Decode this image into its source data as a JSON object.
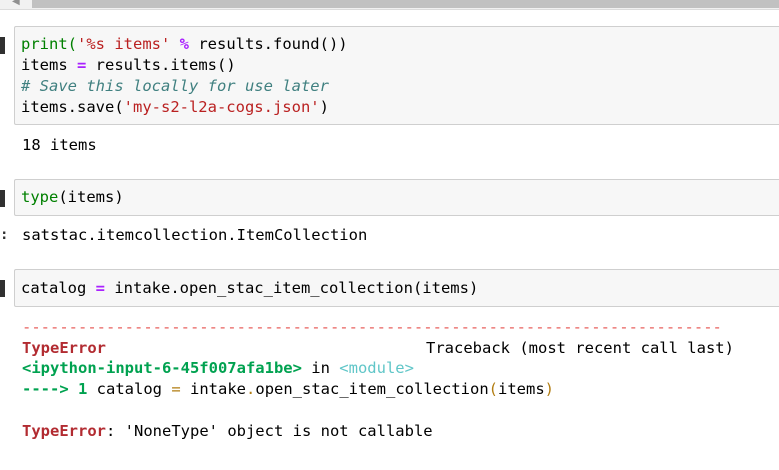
{
  "cells": [
    {
      "id": "cell1",
      "input_lines": [
        [
          "print(",
          "'%s items'",
          " % ",
          "results.found())"
        ],
        [
          "items ",
          "=",
          " results.items()"
        ],
        [
          "# Save this locally for use later"
        ],
        [
          "items.save(",
          "'my-s2-l2a-cogs.json'",
          ")"
        ]
      ],
      "output": "18 items"
    },
    {
      "id": "cell2",
      "input_lines": [
        [
          "type",
          "(items)"
        ]
      ],
      "output": "satstac.itemcollection.ItemCollection"
    },
    {
      "id": "cell3",
      "input_lines": [
        [
          "catalog ",
          "=",
          " intake.open_stac_item_collection(items)"
        ]
      ],
      "traceback": {
        "dashes": "---------------------------------------------------------------------------",
        "error_name": "TypeError",
        "traceback_header": "Traceback (most recent call last)",
        "input_ref": "<ipython-input-6-45f007afa1be>",
        "in_word": " in ",
        "module_ref": "<module>",
        "arrow": "----> ",
        "line_no": "1",
        "code_pre": " catalog ",
        "code_eq": "=",
        "code_mid": " intake",
        "code_dot": ".",
        "code_func": "open_stac_item_collection",
        "code_paren_open": "(",
        "code_arg": "items",
        "code_paren_close": ")",
        "final_error_name": "TypeError",
        "final_message": ": 'NoneType' object is not callable"
      }
    }
  ],
  "colors": {
    "input_bg": "#f7f7f7",
    "builtin": "#008000",
    "string": "#ba2121",
    "operator": "#aa22ff",
    "comment": "#408080",
    "error": "#b22b31",
    "dashes": "#e75c58"
  }
}
